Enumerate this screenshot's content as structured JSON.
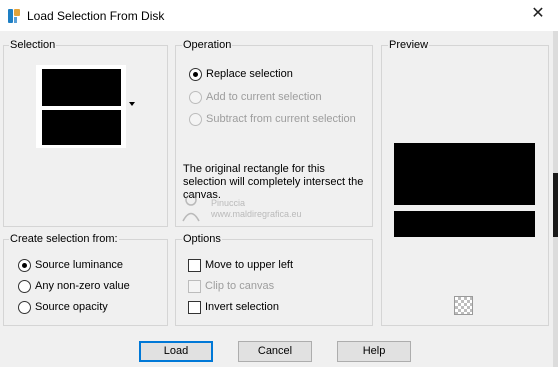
{
  "window": {
    "title": "Load Selection From Disk",
    "close_glyph": "✕"
  },
  "selection_group": {
    "label": "Selection",
    "thumbnail_icon": "selection-thumbnail-icon"
  },
  "operation_group": {
    "label": "Operation",
    "options": [
      {
        "label": "Replace selection",
        "checked": true,
        "enabled": true
      },
      {
        "label": "Add to current selection",
        "checked": false,
        "enabled": false
      },
      {
        "label": "Subtract from current selection",
        "checked": false,
        "enabled": false
      }
    ],
    "info_text": "The original rectangle for this selection will completely intersect the canvas."
  },
  "preview_group": {
    "label": "Preview",
    "transparency_icon": "checkerboard-icon"
  },
  "create_group": {
    "label": "Create selection from:",
    "options": [
      {
        "label": "Source luminance",
        "checked": true
      },
      {
        "label": "Any non-zero value",
        "checked": false
      },
      {
        "label": "Source opacity",
        "checked": false
      }
    ]
  },
  "options_group": {
    "label": "Options",
    "checks": [
      {
        "label": "Move to upper left",
        "checked": false,
        "enabled": true
      },
      {
        "label": "Clip to canvas",
        "checked": false,
        "enabled": false
      },
      {
        "label": "Invert selection",
        "checked": false,
        "enabled": true
      }
    ]
  },
  "watermark": {
    "line1": "Pinuccia",
    "line2": "www.maldiregrafica.eu"
  },
  "buttons": {
    "load": "Load",
    "cancel": "Cancel",
    "help": "Help"
  }
}
